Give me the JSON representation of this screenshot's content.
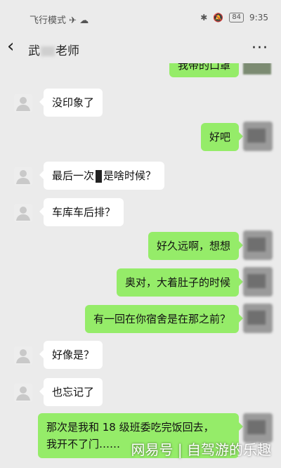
{
  "statusbar": {
    "mode_text": "飞行模式",
    "battery": "84",
    "time": "9:35"
  },
  "nav": {
    "back_icon": "chevron-left-icon",
    "title_prefix": "武",
    "title_suffix": "老师",
    "more_icon": "more-dots-icon"
  },
  "chat": {
    "top_cut_text": "我带的口罩",
    "messages": [
      {
        "side": "in",
        "text": "没印象了"
      },
      {
        "side": "out",
        "text": "好吧"
      },
      {
        "side": "in",
        "text_before": "最后一次",
        "text_after": "是啥时候？"
      },
      {
        "side": "in",
        "text": "车库车后排？"
      },
      {
        "side": "out",
        "text": "好久远啊，想想"
      },
      {
        "side": "out",
        "text": "奥对，大着肚子的时候"
      },
      {
        "side": "out",
        "text": "有一回在你宿舍是在那之前？"
      },
      {
        "side": "in",
        "text": "好像是？"
      },
      {
        "side": "in",
        "text": "也忘记了"
      },
      {
        "side": "out",
        "line1": "那次是我和 18 级班委吃完饭回去，",
        "line2": "我开不了门……"
      }
    ]
  },
  "watermark": "网易号 | 自驾游的乐趣",
  "colors": {
    "background": "#ebebeb",
    "incoming_bubble": "#ffffff",
    "outgoing_bubble": "#95ec69"
  }
}
